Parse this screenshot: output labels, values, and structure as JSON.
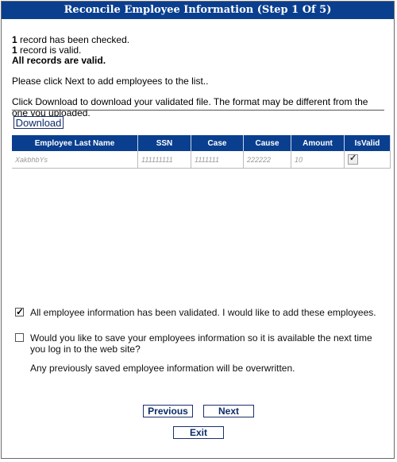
{
  "title": "Reconcile Employee Information (Step 1 Of 5)",
  "summary": {
    "checked_count": "1",
    "checked_text": " record has been checked.",
    "valid_count": "1",
    "valid_text": " record is valid.",
    "all_valid": "All records are valid.",
    "instruction_next": "Please click Next to add employees to the list..",
    "instruction_download": "Click Download to download your validated file. The format may be different from the one you uploaded."
  },
  "download_label": "Download",
  "table": {
    "headers": [
      "Employee Last Name",
      "SSN",
      "Case",
      "Cause",
      "Amount",
      "IsValid"
    ],
    "rows": [
      {
        "last_name": "XakbhbYs",
        "ssn": "111111111",
        "case": "1111111",
        "cause": "222222",
        "amount": "10",
        "is_valid": true
      }
    ]
  },
  "options": {
    "add_employees": {
      "checked": true,
      "label": "All employee information has been validated. I would like to add these employees."
    },
    "save_info": {
      "checked": false,
      "label": "Would you like to save your employees information so it is available the next time you log in to the web site?",
      "note": "Any previously saved employee information will be overwritten."
    }
  },
  "buttons": {
    "previous": "Previous",
    "next": "Next",
    "exit": "Exit"
  }
}
